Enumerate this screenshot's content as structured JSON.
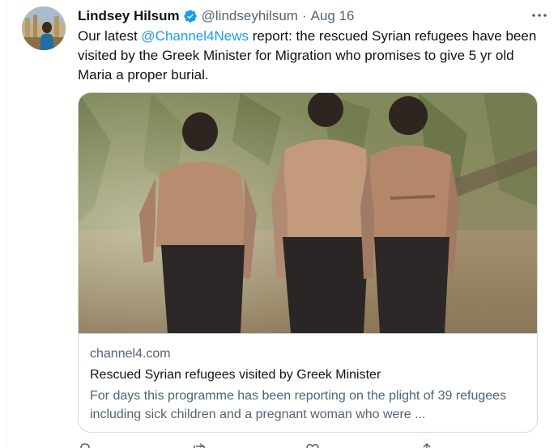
{
  "author": {
    "name": "Lindsey Hilsum",
    "handle": "@lindseyhilsum",
    "separator": "·",
    "date": "Aug 16"
  },
  "tweet": {
    "text_before": "Our latest ",
    "mention": "@Channel4News",
    "text_after": " report: the rescued Syrian refugees have been visited by the Greek Minister for Migration who promises to give 5 yr old Maria a proper burial."
  },
  "card": {
    "domain": "channel4.com",
    "title": "Rescued Syrian refugees visited by Greek Minister",
    "description": "For days this programme has been reporting on the plight of 39 refugees including sick children and a pregnant woman who were ..."
  },
  "icons": {
    "verified": "verified-badge-icon",
    "more": "more-icon",
    "reply": "reply-icon",
    "retweet": "retweet-icon",
    "like": "like-icon",
    "share": "share-icon"
  },
  "colors": {
    "accent": "#1d9bf0",
    "text": "#0f1419",
    "secondary": "#536471",
    "border": "#cfd9de"
  }
}
